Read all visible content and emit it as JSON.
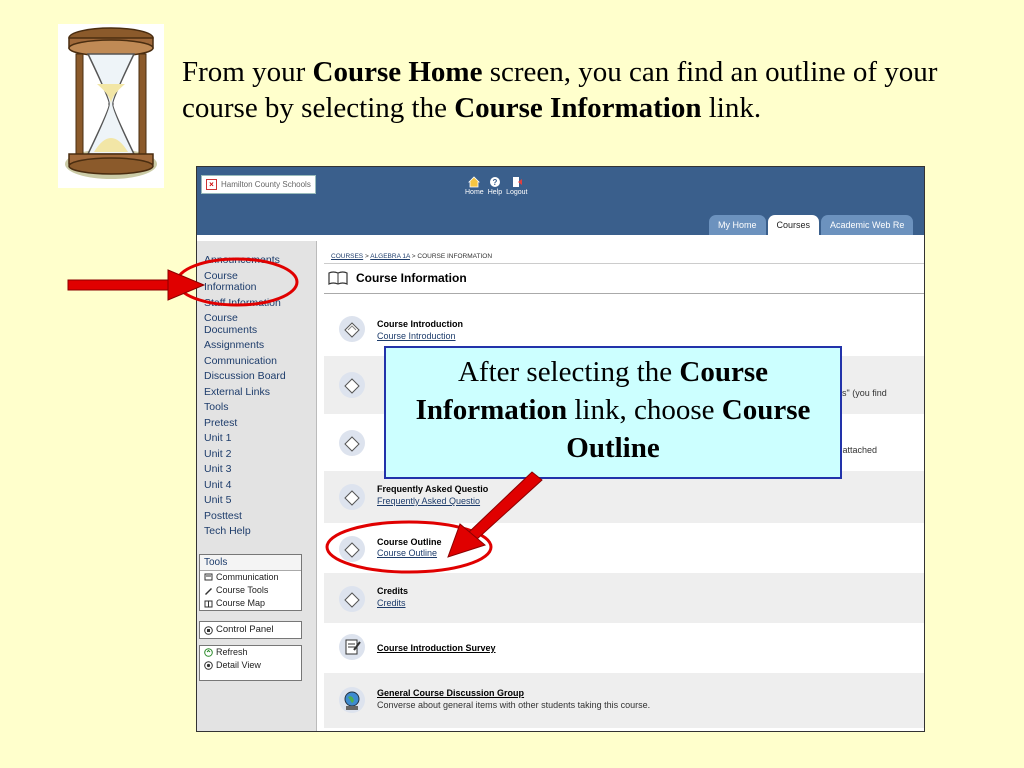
{
  "instruction": {
    "part1": "From your ",
    "bold1": "Course Home",
    "part2": " screen, you can find an outline of your course by selecting the ",
    "bold2": "Course Information",
    "part3": " link."
  },
  "screenshot": {
    "logo_text": "Hamilton County Schools",
    "top_nav": [
      "Home",
      "Help",
      "Logout"
    ],
    "tabs": [
      "My Home",
      "Courses",
      "Academic Web Re"
    ],
    "active_tab": "Courses",
    "sidebar": {
      "items": [
        "Announcements",
        "Course Information",
        "Staff Information",
        "Course Documents",
        "Assignments",
        "Communication",
        "Discussion Board",
        "External Links",
        "Tools",
        "Pretest",
        "Unit 1",
        "Unit 2",
        "Unit 3",
        "Unit 4",
        "Unit 5",
        "Posttest",
        "Tech Help"
      ],
      "tools_heading": "Tools",
      "tools": [
        "Communication",
        "Course Tools",
        "Course Map"
      ],
      "control_panel": "Control Panel",
      "view_options": [
        "Refresh",
        "Detail View"
      ]
    },
    "breadcrumb": [
      "COURSES",
      "ALGEBRA 1A",
      "COURSE INFORMATION"
    ],
    "breadcrumb_sep": " > ",
    "page_title": "Course Information",
    "items": [
      {
        "title": "Course Introduction",
        "link": "Course Introduction"
      },
      {
        "visible_fragment": "s\" (you find"
      },
      {
        "visible_fragment": "e attached"
      },
      {
        "title": "Frequently Asked Questio",
        "link": "Frequently Asked Questio"
      },
      {
        "title": "Course Outline",
        "link": "Course Outline"
      },
      {
        "title": "Credits",
        "link": "Credits"
      },
      {
        "link": "Course Introduction Survey"
      },
      {
        "link": "General Course Discussion Group",
        "desc": "Converse about general items with other students taking this course."
      }
    ]
  },
  "callout": {
    "part1": "After selecting the ",
    "bold1": "Course Information",
    "part2": " link, choose ",
    "bold2": "Course Outline"
  },
  "colors": {
    "slide_bg": "#FFFFCC",
    "header_blue": "#3A5F8C",
    "callout_bg": "#CCFFFF",
    "highlight_red": "#E00000"
  }
}
